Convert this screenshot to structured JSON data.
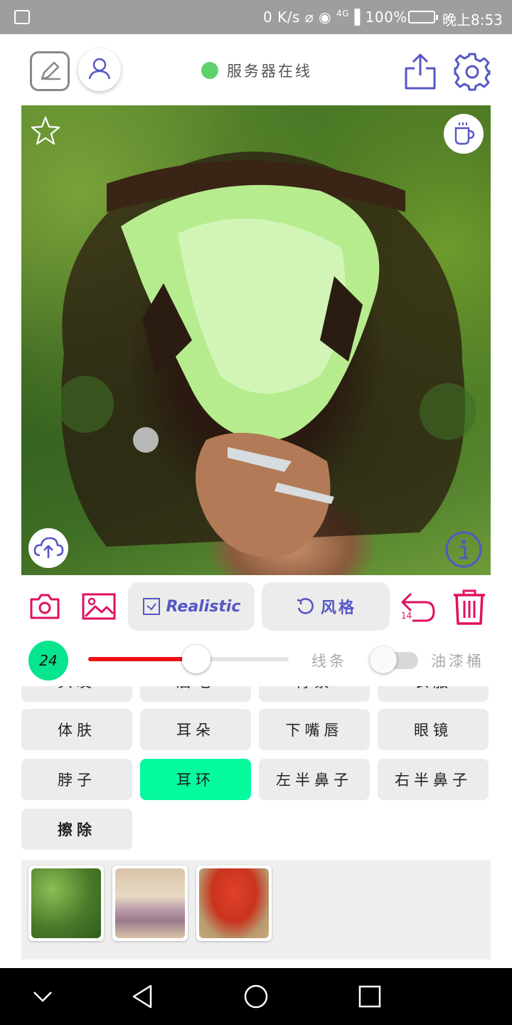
{
  "status_bar": {
    "network_speed": "0 K/s",
    "signal_label": "4G",
    "battery_percent": "100%",
    "time": "晚上8:53"
  },
  "header": {
    "server_status": "服务器在线",
    "server_status_color": "#5fd36b"
  },
  "icons": {
    "edit": "edit-square-icon",
    "avatar": "user-icon",
    "share": "share-upload-icon",
    "settings": "gear-icon",
    "favorite": "star-outline-icon",
    "coffee": "coffee-cup-icon",
    "upload": "cloud-upload-icon",
    "info": "info-circle-icon",
    "camera": "camera-icon",
    "gallery": "image-icon",
    "undo": "undo-icon",
    "delete": "trash-icon"
  },
  "toolbar": {
    "realistic_label": "Realistic",
    "realistic_checked": false,
    "style_label": "风格",
    "undo_count": "14"
  },
  "brush": {
    "size": "24",
    "size_color": "#08e58f",
    "slider_fraction": 0.54,
    "slider_color": "#ee1111",
    "line_label": "线条",
    "bucket_label": "油漆桶",
    "bucket_enabled": false
  },
  "segments": {
    "rows": [
      [
        "头发",
        "眉毛",
        "背景",
        "衣服"
      ],
      [
        "体肤",
        "耳朵",
        "下嘴唇",
        "眼镜"
      ],
      [
        "脖子",
        "耳环",
        "左半鼻子",
        "右半鼻子"
      ],
      [
        "擦除"
      ]
    ],
    "active": "耳环",
    "active_color": "#05fb9e"
  },
  "style_thumbnails": [
    "green-foliage",
    "pink-flower-meadow",
    "red-tree"
  ]
}
